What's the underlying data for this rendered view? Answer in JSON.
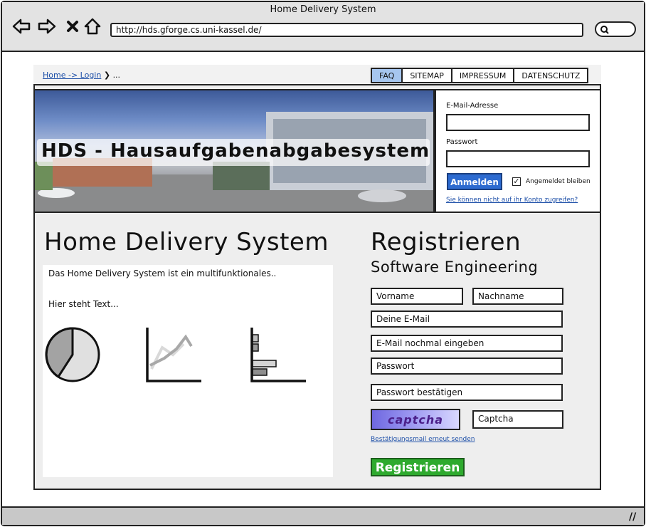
{
  "window": {
    "title": "Home Delivery System",
    "url": "http://hds.gforge.cs.uni-kassel.de/"
  },
  "nav": {
    "breadcrumb_link": "Home -> Login",
    "breadcrumb_sep": "❯",
    "breadcrumb_rest": "...",
    "tabs": [
      {
        "label": "FAQ",
        "active": true
      },
      {
        "label": "SITEMAP",
        "active": false
      },
      {
        "label": "IMPRESSUM",
        "active": false
      },
      {
        "label": "DATENSCHUTZ",
        "active": false
      }
    ]
  },
  "hero": {
    "title": "HDS - Hausaufgabenabgabesystem"
  },
  "login": {
    "email_label": "E-Mail-Adresse",
    "email_value": "",
    "password_label": "Passwort",
    "password_value": "",
    "submit": "Anmelden",
    "remember_label": "Angemeldet bleiben",
    "remember_checked": true,
    "help_link": "Sie können nicht auf ihr Konto zugreifen?"
  },
  "main": {
    "heading": "Home Delivery System",
    "intro": "Das Home Delivery System ist ein multifunktionales..",
    "text": "Hier steht Text..."
  },
  "register": {
    "heading": "Registrieren",
    "subheading": "Software Engineering",
    "firstname_placeholder": "Vorname",
    "lastname_placeholder": "Nachname",
    "email_placeholder": "Deine E-Mail",
    "email_repeat_placeholder": "E-Mail nochmal eingeben",
    "password_placeholder": "Passwort",
    "password_confirm_placeholder": "Passwort bestätigen",
    "captcha_image_text": "captcha",
    "captcha_placeholder": "Captcha",
    "resend_link": "Bestätigungsmail erneut senden",
    "submit": "Registrieren"
  },
  "colors": {
    "accent_blue": "#2d6bd0",
    "tab_active": "#a6c6ef",
    "register_green": "#2eaa2e",
    "link": "#1d4fa8"
  }
}
